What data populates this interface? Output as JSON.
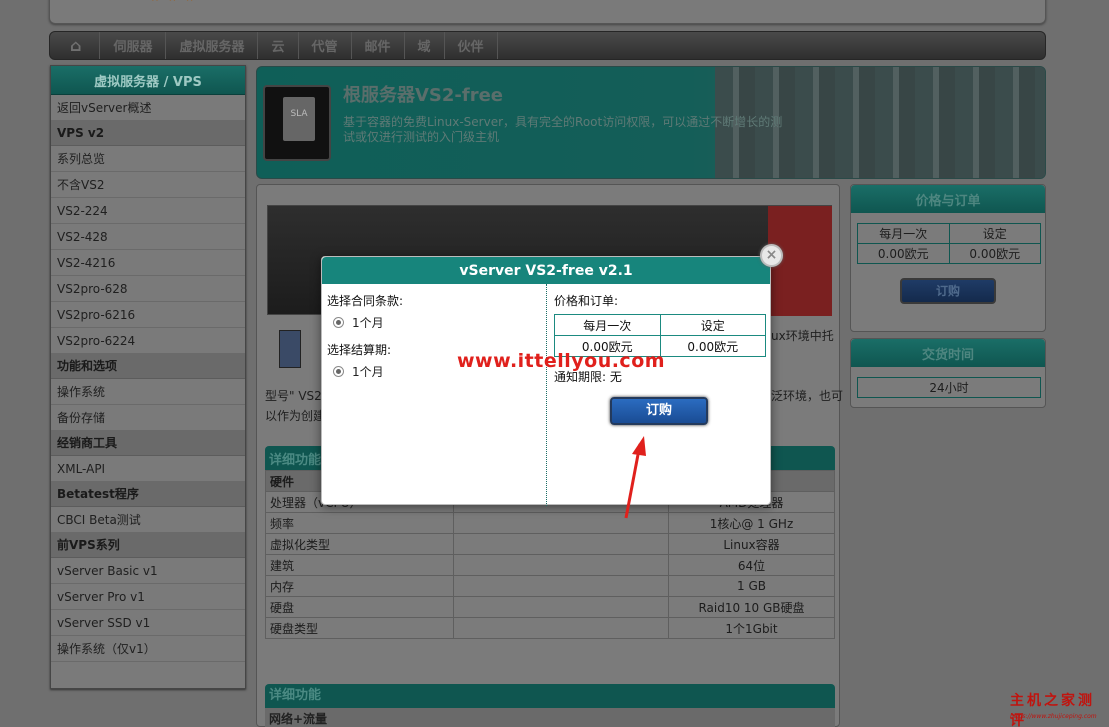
{
  "nav": {
    "items": [
      "伺服器",
      "虚拟服务器",
      "云",
      "代管",
      "邮件",
      "域",
      "伙伴"
    ]
  },
  "sidebar": {
    "header": "虚拟服务器 / VPS",
    "back": "返回vServer概述",
    "sections": [
      {
        "title": "VPS v2",
        "items": [
          "系列总览",
          "不含VS2",
          "VS2-224",
          "VS2-428",
          "VS2-4216",
          "VS2pro-628",
          "VS2pro-6216",
          "VS2pro-6224"
        ]
      },
      {
        "title": "功能和选项",
        "items": [
          "操作系统",
          "备份存储"
        ]
      },
      {
        "title": "经销商工具",
        "items": [
          "XML-API"
        ]
      },
      {
        "title": "Betatest程序",
        "items": [
          "CBCI Beta测试"
        ]
      },
      {
        "title": "前VPS系列",
        "items": [
          "vServer Basic v1",
          "vServer Pro v1",
          "vServer SSD v1",
          "操作系统（仅v1）"
        ]
      }
    ]
  },
  "banner": {
    "title": "根服务器VS2-free",
    "description": "基于容器的免费Linux-Server，具有完全的Root访问权限，可以通过不断增长的测试或仅进行测试的入门级主机"
  },
  "content": {
    "text1": "ux环境中托",
    "text2a": "型号\" VS2",
    "text2b": "泛环境，也可",
    "text3": "以作为创建",
    "spec_header": "详细功能",
    "spec_rows": [
      {
        "label": "硬件",
        "value": "",
        "header": true
      },
      {
        "label": "处理器（vCPU）",
        "value": "AMD处理器"
      },
      {
        "label": "频率",
        "value": "1核心@ 1 GHz"
      },
      {
        "label": "虚拟化类型",
        "value": "Linux容器"
      },
      {
        "label": "建筑",
        "value": "64位"
      },
      {
        "label": "内存",
        "value": "1 GB"
      },
      {
        "label": "硬盘",
        "value": "Raid10 10 GB硬盘"
      },
      {
        "label": "硬盘类型",
        "value": "1个1Gbit"
      }
    ],
    "spec2_header": "详细功能",
    "spec2_row": "网络+流量"
  },
  "right": {
    "price_header": "价格与订单",
    "price_cols": [
      "每月一次",
      "设定"
    ],
    "price_vals": [
      "0.00欧元",
      "0.00欧元"
    ],
    "order_button": "订购",
    "delivery_header": "交货时间",
    "delivery_value": "24小时"
  },
  "modal": {
    "title": "vServer VS2-free v2.1",
    "contract_label": "选择合同条款:",
    "contract_option": "1个月",
    "billing_label": "选择结算期:",
    "billing_option": "1个月",
    "price_label": "价格和订单:",
    "price_cols": [
      "每月一次",
      "设定"
    ],
    "price_vals": [
      "0.00欧元",
      "0.00欧元"
    ],
    "notice": "通知期限: 无",
    "order_button": "订购",
    "close_symbol": "×"
  },
  "watermark": "www.ittellyou.com",
  "corner": {
    "logo": "主机之家测评",
    "url": "https://www.zhujiceping.com"
  }
}
